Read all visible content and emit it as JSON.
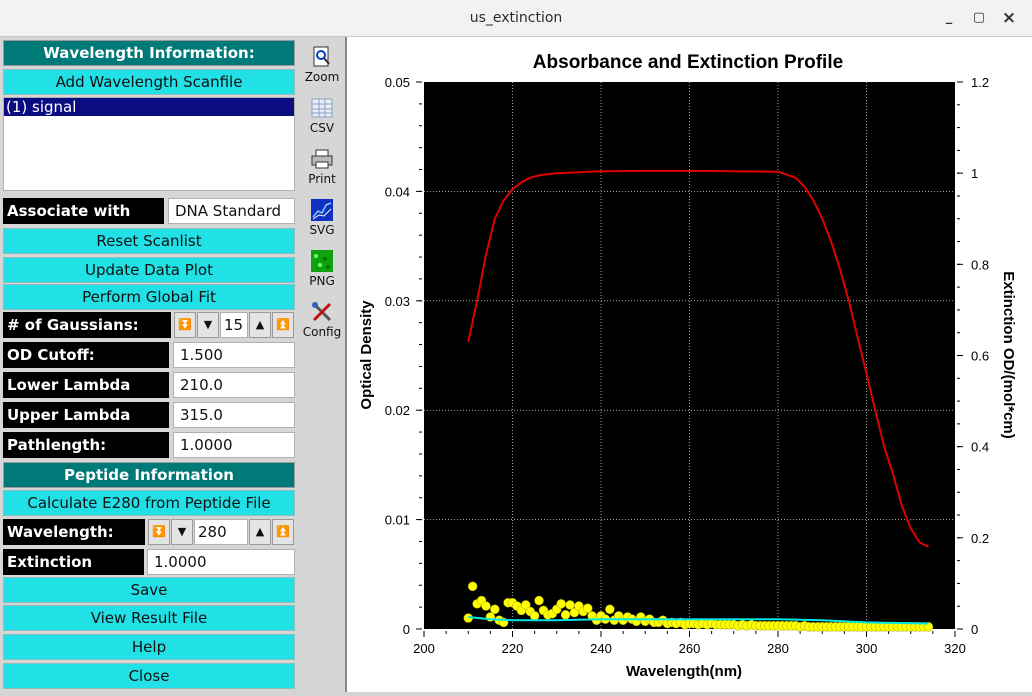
{
  "window": {
    "title": "us_extinction",
    "minimize": "_",
    "maximize": "▢",
    "close": "×"
  },
  "left": {
    "wavelength_header": "Wavelength Information:",
    "add_scanfile": "Add Wavelength Scanfile",
    "scan_list": [
      "(1) signal"
    ],
    "associate_label": "Associate with Run:",
    "associate_value": "DNA Standard",
    "reset_scanlist": "Reset Scanlist",
    "update_plot": "Update Data Plot",
    "global_fit": "Perform Global Fit",
    "gaussians_label": "# of Gaussians:",
    "gaussians_value": "15",
    "od_cutoff_label": "OD Cutoff:",
    "od_cutoff_value": "1.500",
    "lower_label": "Lower Lambda Limit",
    "lower_value": "210.0",
    "upper_label": "Upper Lambda Limit",
    "upper_value": "315.0",
    "pathlength_label": "Pathlength:",
    "pathlength_value": "1.0000",
    "peptide_header": "Peptide Information",
    "calc_e280": "Calculate E280 from Peptide File",
    "wavelength_label": "Wavelength:",
    "wavelength_value": "280",
    "ext_label": "Extinction Coeff.:",
    "ext_value": "1.0000",
    "save": "Save",
    "view_result": "View Result File",
    "help": "Help",
    "close": "Close"
  },
  "tools": {
    "zoom": "Zoom",
    "csv": "CSV",
    "print": "Print",
    "svg": "SVG",
    "png": "PNG",
    "config": "Config"
  },
  "chart_data": {
    "type": "scatter",
    "title": "Absorbance and Extinction Profile",
    "xlabel": "Wavelength(nm)",
    "ylabel": "Optical Density",
    "y2label": "Extinction OD/(mol*cm)",
    "xlim": [
      200,
      320
    ],
    "ylim": [
      0,
      0.05
    ],
    "y2lim": [
      0,
      1.2
    ],
    "xticks": [
      "200",
      "220",
      "240",
      "260",
      "280",
      "300",
      "320"
    ],
    "yticks": [
      "0",
      "0.01",
      "0.02",
      "0.03",
      "0.04",
      "0.05"
    ],
    "y2ticks": [
      "0",
      "0.2",
      "0.4",
      "0.6",
      "0.8",
      "1",
      "1.2"
    ],
    "grid": true,
    "colors": {
      "background": "#000000",
      "points": "#ffff00",
      "fit": "#00e5e5",
      "extinction": "#e00000",
      "grid": "#ffffff"
    },
    "series": [
      {
        "kind": "points",
        "axis": "left",
        "x": [
          210,
          211,
          212,
          213,
          214,
          215,
          216,
          217,
          218,
          219,
          220,
          221,
          222,
          223,
          224,
          225,
          226,
          227,
          228,
          229,
          230,
          231,
          232,
          233,
          234,
          235,
          236,
          237,
          238,
          239,
          240,
          241,
          242,
          243,
          244,
          245,
          246,
          247,
          248,
          249,
          250,
          251,
          252,
          253,
          254,
          255,
          256,
          257,
          258,
          259,
          260,
          261,
          262,
          263,
          264,
          265,
          266,
          267,
          268,
          269,
          270,
          271,
          272,
          273,
          274,
          275,
          276,
          277,
          278,
          279,
          280,
          281,
          282,
          283,
          284,
          285,
          286,
          287,
          288,
          289,
          290,
          291,
          292,
          293,
          294,
          295,
          296,
          297,
          298,
          299,
          300,
          301,
          302,
          303,
          304,
          305,
          306,
          307,
          308,
          309,
          310,
          311,
          312,
          313,
          314
        ],
        "y": [
          0.001,
          0.0039,
          0.0023,
          0.0026,
          0.0021,
          0.0011,
          0.0018,
          0.0008,
          0.0006,
          0.0024,
          0.0024,
          0.0021,
          0.0017,
          0.0022,
          0.0016,
          0.0012,
          0.0026,
          0.0017,
          0.0013,
          0.0014,
          0.0018,
          0.0023,
          0.0013,
          0.0022,
          0.0015,
          0.0021,
          0.0016,
          0.0019,
          0.0012,
          0.0008,
          0.0012,
          0.0009,
          0.0018,
          0.0008,
          0.0012,
          0.0008,
          0.0011,
          0.0009,
          0.0007,
          0.0011,
          0.0007,
          0.0009,
          0.0006,
          0.0006,
          0.0008,
          0.0005,
          0.0006,
          0.0005,
          0.0006,
          0.0004,
          0.0005,
          0.0005,
          0.0004,
          0.0005,
          0.0004,
          0.0005,
          0.0004,
          0.0004,
          0.0004,
          0.0004,
          0.0004,
          0.0003,
          0.0004,
          0.0003,
          0.0004,
          0.0003,
          0.0003,
          0.0003,
          0.0003,
          0.0003,
          0.0003,
          0.0003,
          0.0003,
          0.0003,
          0.0003,
          0.0002,
          0.0003,
          0.0002,
          0.0002,
          0.0002,
          0.0002,
          0.0002,
          0.0002,
          0.0002,
          0.0002,
          0.0002,
          0.0002,
          0.0002,
          0.0002,
          0.0002,
          0.0002,
          0.0002,
          0.0002,
          0.0002,
          0.0002,
          0.0002,
          0.0002,
          0.0002,
          0.0002,
          0.0002,
          0.0002,
          0.0002,
          0.0002,
          0.0002,
          0.0002
        ]
      },
      {
        "kind": "line",
        "axis": "left",
        "x": [
          210,
          215,
          220,
          230,
          240,
          260,
          280,
          290,
          300,
          314
        ],
        "y": [
          0.0011,
          0.0009,
          0.0008,
          0.0008,
          0.0009,
          0.0009,
          0.0009,
          0.0008,
          0.0006,
          0.0005
        ]
      },
      {
        "kind": "line",
        "axis": "right",
        "x": [
          210,
          212,
          214,
          216,
          218,
          220,
          222,
          224,
          226,
          228,
          230,
          235,
          240,
          250,
          260,
          270,
          280,
          284,
          286,
          288,
          290,
          292,
          294,
          296,
          298,
          300,
          302,
          304,
          306,
          308,
          310,
          312,
          314
        ],
        "y": [
          0.63,
          0.72,
          0.82,
          0.9,
          0.94,
          0.965,
          0.98,
          0.99,
          0.995,
          0.998,
          1.0,
          1.002,
          1.004,
          1.005,
          1.005,
          1.004,
          1.003,
          0.99,
          0.97,
          0.94,
          0.9,
          0.85,
          0.79,
          0.72,
          0.64,
          0.56,
          0.48,
          0.4,
          0.34,
          0.27,
          0.22,
          0.19,
          0.18
        ]
      }
    ]
  }
}
